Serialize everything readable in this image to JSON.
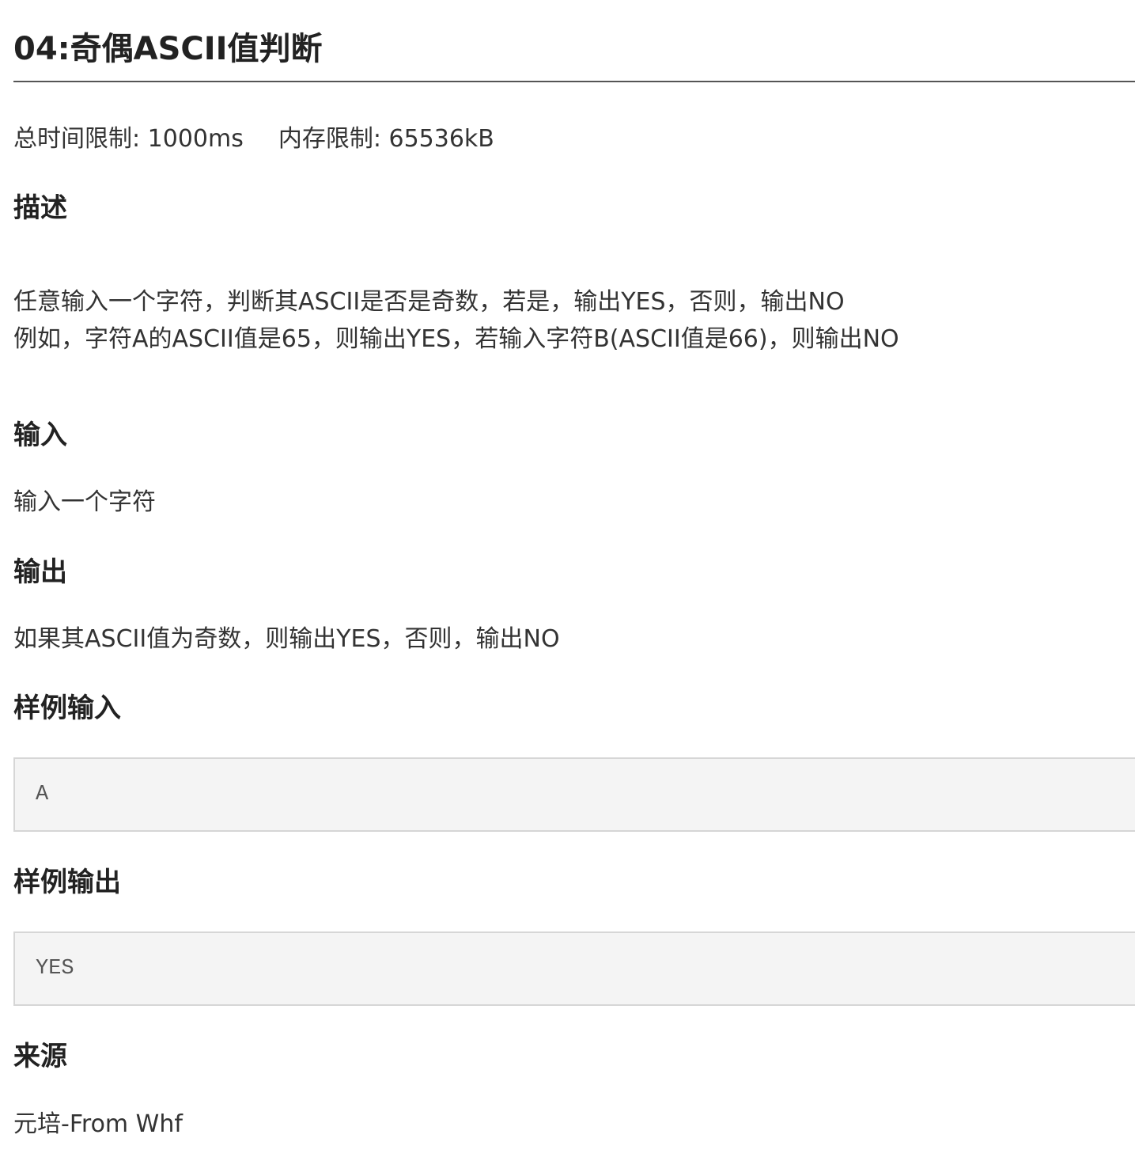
{
  "title": "04:奇偶ASCII值判断",
  "limits": {
    "time": "总时间限制: 1000ms",
    "memory": "内存限制: 65536kB"
  },
  "sections": {
    "description": {
      "heading": "描述",
      "lines": [
        "任意输入一个字符，判断其ASCII是否是奇数，若是，输出YES，否则，输出NO",
        "例如，字符A的ASCII值是65，则输出YES，若输入字符B(ASCII值是66)，则输出NO"
      ]
    },
    "input": {
      "heading": "输入",
      "text": "输入一个字符"
    },
    "output": {
      "heading": "输出",
      "text": "如果其ASCII值为奇数，则输出YES，否则，输出NO"
    },
    "sample_input": {
      "heading": "样例输入",
      "content": "A"
    },
    "sample_output": {
      "heading": "样例输出",
      "content": "YES"
    },
    "source": {
      "heading": "来源",
      "text": "元培-From Whf"
    }
  }
}
